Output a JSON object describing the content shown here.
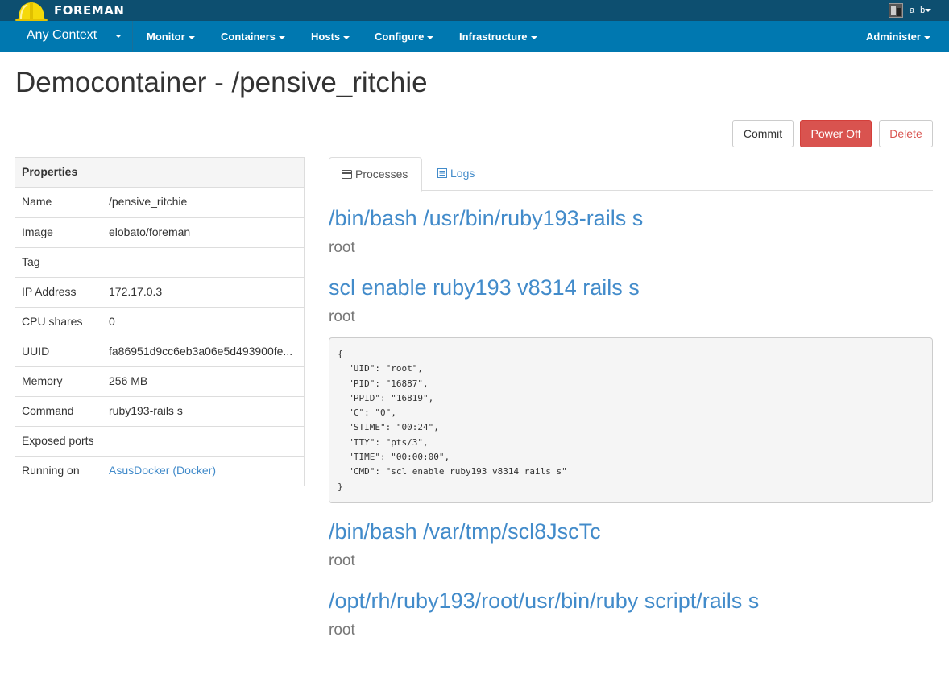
{
  "topbar": {
    "brand": "FOREMAN",
    "user_name": "a b",
    "colors": {
      "topbar_bg": "#0d4f70",
      "navbar_bg": "#0078b0"
    }
  },
  "navbar": {
    "context": "Any Context",
    "items": [
      "Monitor",
      "Containers",
      "Hosts",
      "Configure",
      "Infrastructure"
    ],
    "admin": "Administer"
  },
  "page": {
    "title": "Democontainer - /pensive_ritchie"
  },
  "actions": {
    "commit": "Commit",
    "power_off": "Power Off",
    "delete": "Delete"
  },
  "properties": {
    "header": "Properties",
    "rows": [
      {
        "key": "Name",
        "value": "/pensive_ritchie"
      },
      {
        "key": "Image",
        "value": "elobato/foreman"
      },
      {
        "key": "Tag",
        "value": ""
      },
      {
        "key": "IP Address",
        "value": "172.17.0.3"
      },
      {
        "key": "CPU shares",
        "value": "0"
      },
      {
        "key": "UUID",
        "value": "fa86951d9cc6eb3a06e5d493900fe..."
      },
      {
        "key": "Memory",
        "value": "256 MB"
      },
      {
        "key": "Command",
        "value": "ruby193-rails s"
      },
      {
        "key": "Exposed ports",
        "value": ""
      },
      {
        "key": "Running on",
        "value": "AsusDocker (Docker)"
      }
    ]
  },
  "tabs": {
    "processes": "Processes",
    "logs": "Logs"
  },
  "processes": [
    {
      "command": "/bin/bash /usr/bin/ruby193-rails s",
      "user": "root"
    },
    {
      "command": "scl enable ruby193 v8314 rails s",
      "user": "root"
    },
    {
      "command": "/bin/bash /var/tmp/scl8JscTc",
      "user": "root"
    },
    {
      "command": "/opt/rh/ruby193/root/usr/bin/ruby script/rails s",
      "user": "root"
    }
  ],
  "process_detail": "{\n  \"UID\": \"root\",\n  \"PID\": \"16887\",\n  \"PPID\": \"16819\",\n  \"C\": \"0\",\n  \"STIME\": \"00:24\",\n  \"TTY\": \"pts/3\",\n  \"TIME\": \"00:00:00\",\n  \"CMD\": \"scl enable ruby193 v8314 rails s\"\n}"
}
